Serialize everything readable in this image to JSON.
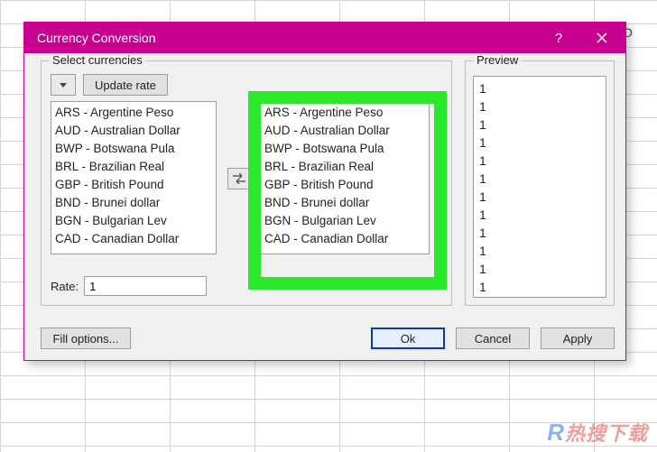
{
  "spreadsheet": {
    "column_letter_visible": "O"
  },
  "dialog": {
    "title": "Currency Conversion",
    "select_group_label": "Select currencies",
    "update_rate_btn": "Update rate",
    "left_list": [
      "ARS - Argentine Peso",
      "AUD - Australian Dollar",
      "BWP - Botswana Pula",
      "BRL - Brazilian Real",
      "GBP - British Pound",
      "BND - Brunei dollar",
      "BGN - Bulgarian Lev",
      "CAD - Canadian Dollar"
    ],
    "right_list": [
      "ARS - Argentine Peso",
      "AUD - Australian Dollar",
      "BWP - Botswana Pula",
      "BRL - Brazilian Real",
      "GBP - British Pound",
      "BND - Brunei dollar",
      "BGN - Bulgarian Lev",
      "CAD - Canadian Dollar"
    ],
    "rate_label": "Rate:",
    "rate_value": "1",
    "preview_group_label": "Preview",
    "preview_values": [
      "1",
      "1",
      "1",
      "1",
      "1",
      "1",
      "1",
      "1",
      "1",
      "1",
      "1",
      "1"
    ],
    "fill_options_btn": "Fill options...",
    "ok_btn": "Ok",
    "cancel_btn": "Cancel",
    "apply_btn": "Apply"
  },
  "watermark": {
    "r": "R",
    "text": "热搜下载"
  }
}
